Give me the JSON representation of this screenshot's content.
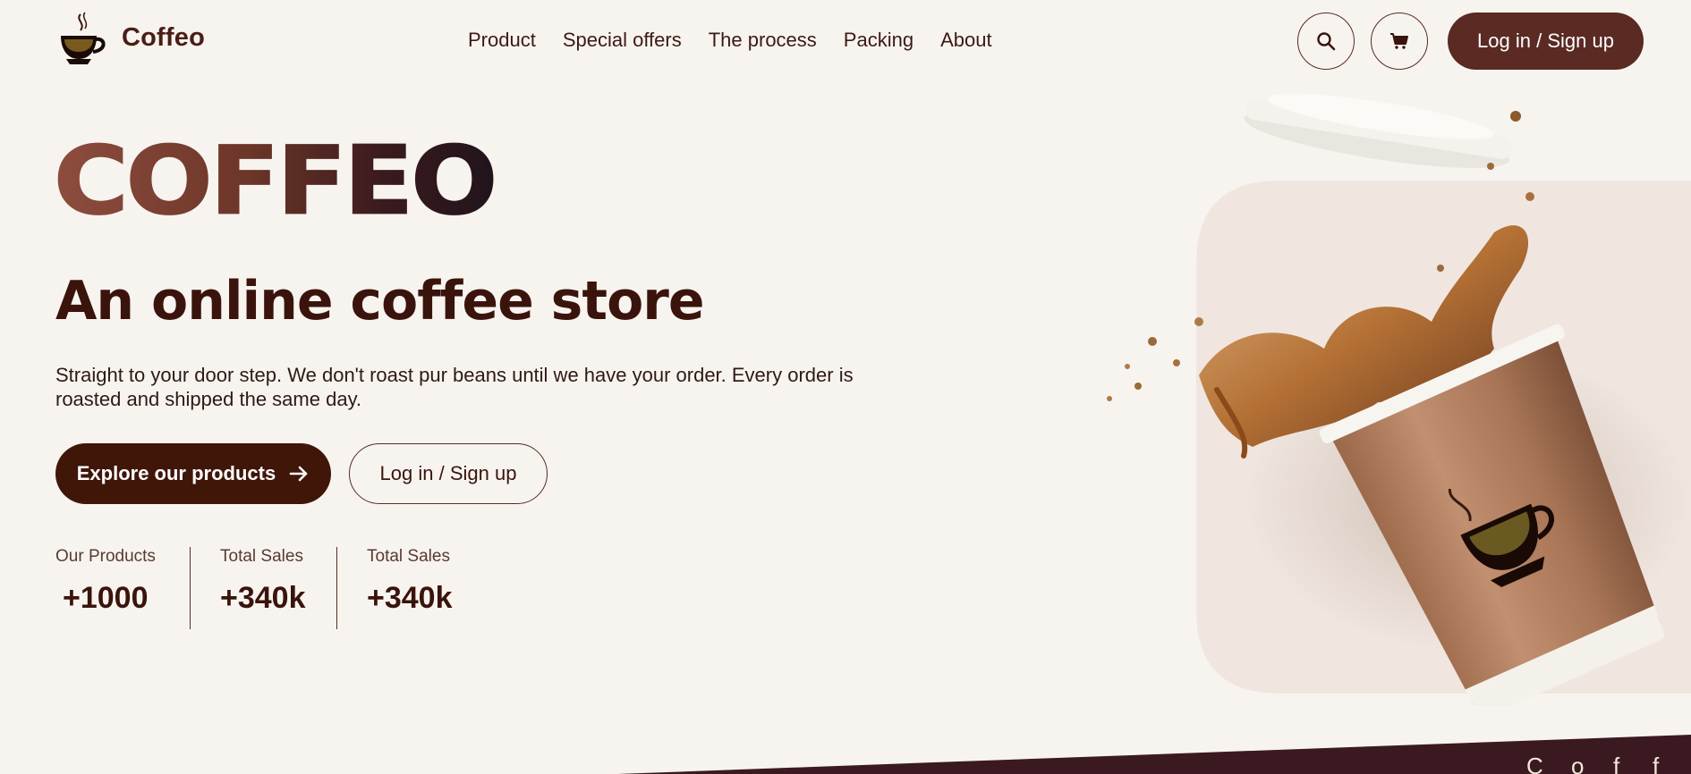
{
  "header": {
    "brand": "Coffeo",
    "nav": [
      "Product",
      "Special offers",
      "The process",
      "Packing",
      "About"
    ],
    "login_label": "Log in / Sign up",
    "icons": {
      "logo": "coffee-cup-logo-icon",
      "search": "search-icon",
      "cart": "cart-icon"
    }
  },
  "hero": {
    "title": "COFFEO",
    "subtitle": "An online coffee store",
    "description": "Straight to your door step. We don't roast pur beans until we have your order. Every order is roasted and shipped the same day.",
    "explore_label": "Explore our products",
    "login_label": "Log in / Sign up",
    "image": "coffee-cup-splash-image"
  },
  "stats": [
    {
      "label": "Our Products",
      "value": "+1000"
    },
    {
      "label": "Total Sales",
      "value": "+340k"
    },
    {
      "label": "Total Sales",
      "value": "+340k"
    }
  ],
  "footer_band": {
    "letters": [
      "C",
      "o",
      "f",
      "f"
    ]
  },
  "colors": {
    "background": "#f7f4f0",
    "primary": "#5a2a23",
    "primary_dark": "#401609",
    "text": "#3a140c",
    "panel": "#f0e6df"
  }
}
